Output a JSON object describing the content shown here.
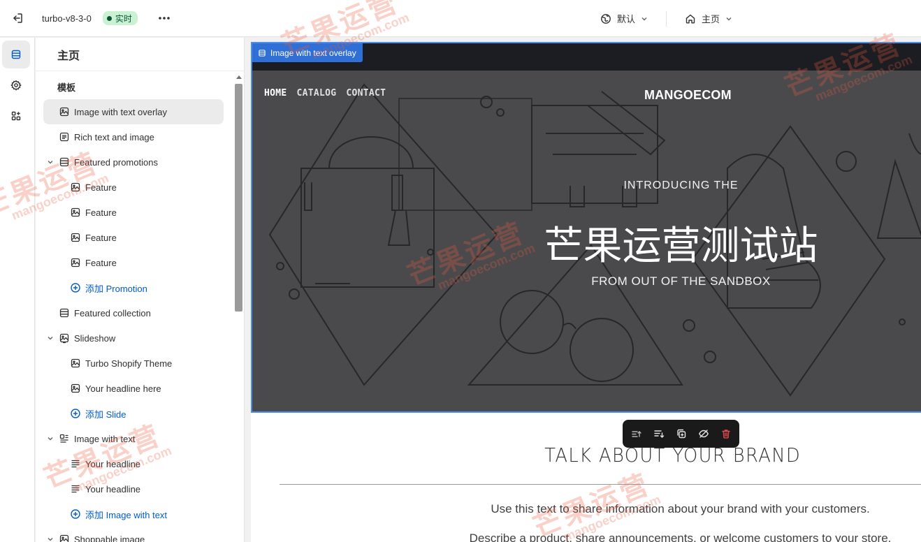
{
  "topbar": {
    "theme_name": "turbo-v8-3-0",
    "status_badge": "实时",
    "locale_selector": "默认",
    "page_selector": "主页"
  },
  "sidebar": {
    "title": "主页",
    "section_label": "模板",
    "items": [
      {
        "label": "Image with text overlay"
      },
      {
        "label": "Rich text and image"
      },
      {
        "label": "Featured promotions"
      },
      {
        "label": "Feature"
      },
      {
        "label": "Feature"
      },
      {
        "label": "Feature"
      },
      {
        "label": "Feature"
      },
      {
        "label": "添加 Promotion"
      },
      {
        "label": "Featured collection"
      },
      {
        "label": "Slideshow"
      },
      {
        "label": "Turbo Shopify Theme"
      },
      {
        "label": "Your headline here"
      },
      {
        "label": "添加 Slide"
      },
      {
        "label": "Image with text"
      },
      {
        "label": "Your headline"
      },
      {
        "label": "Your headline"
      },
      {
        "label": "添加 Image with text"
      },
      {
        "label": "Shoppable image"
      }
    ]
  },
  "preview": {
    "section_label": "Image with text overlay",
    "nav": [
      "HOME",
      "CATALOG",
      "CONTACT"
    ],
    "logo": "MANGOECOM",
    "hero_subtitle_top": "INTRODUCING THE",
    "hero_title": "芒果运营测试站",
    "hero_subtitle_bottom": "FROM OUT OF THE SANDBOX",
    "brand_title": "TALK ABOUT YOUR BRAND",
    "brand_text_1": "Use this text to share information about your brand with your customers.",
    "brand_text_2": "Describe a product, share announcements, or welcome customers to your store."
  },
  "watermark": {
    "text_cn": "芒果运营",
    "text_en": "mangoecom.com"
  },
  "colors": {
    "accent": "#005bd3",
    "selection_outline": "#4f8ee8",
    "badge_bg": "#c9f2d2",
    "hero_bg": "#4a4a4d",
    "delete": "#e5484d"
  }
}
